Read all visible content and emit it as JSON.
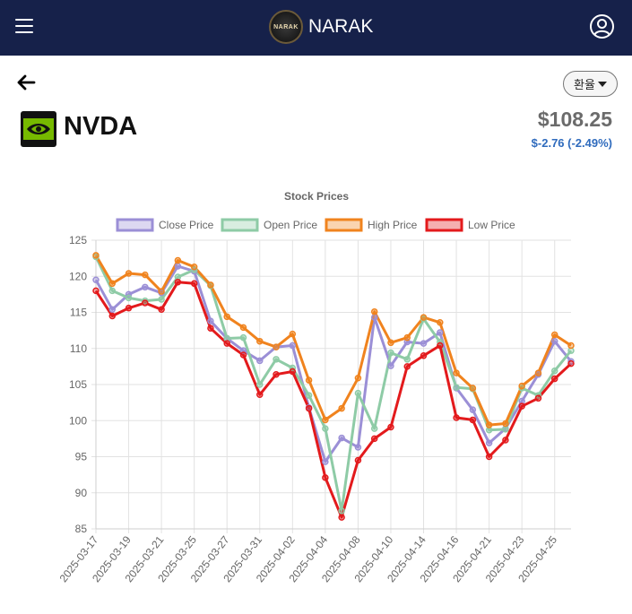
{
  "header": {
    "brand_name": "NARAK",
    "logo_text": "NARAK",
    "menu_icon": "hamburger-menu-icon",
    "account_icon": "user-circle-icon",
    "background": "#16214a"
  },
  "controls": {
    "back_icon": "arrow-left-icon",
    "currency_label": "환율"
  },
  "stock": {
    "ticker": "NVDA",
    "price": "$108.25",
    "change": "$-2.76 (-2.49%)",
    "change_color": "#2f6bbd",
    "logo_icon": "nvidia-eye-icon"
  },
  "chart_data": {
    "type": "line",
    "title": "Stock Prices",
    "legend_position": "top",
    "grid": true,
    "ylim": [
      85,
      125
    ],
    "y_ticks": [
      125,
      120,
      115,
      110,
      105,
      100,
      95,
      90,
      85
    ],
    "x_tick_labels": [
      "2025-03-17",
      "2025-03-19",
      "2025-03-21",
      "2025-03-25",
      "2025-03-27",
      "2025-03-31",
      "2025-04-02",
      "2025-04-04",
      "2025-04-08",
      "2025-04-10",
      "2025-04-14",
      "2025-04-16",
      "2025-04-21",
      "2025-04-23",
      "2025-04-25"
    ],
    "x": [
      "2025-03-17",
      "2025-03-18",
      "2025-03-19",
      "2025-03-20",
      "2025-03-21",
      "2025-03-24",
      "2025-03-25",
      "2025-03-26",
      "2025-03-27",
      "2025-03-28",
      "2025-03-31",
      "2025-04-01",
      "2025-04-02",
      "2025-04-03",
      "2025-04-04",
      "2025-04-07",
      "2025-04-08",
      "2025-04-09",
      "2025-04-10",
      "2025-04-11",
      "2025-04-14",
      "2025-04-15",
      "2025-04-16",
      "2025-04-17",
      "2025-04-21",
      "2025-04-22",
      "2025-04-23",
      "2025-04-24",
      "2025-04-25",
      "2025-04-28"
    ],
    "series": [
      {
        "name": "Close Price",
        "color": "#9b8fd6",
        "values": [
          119.5,
          115.4,
          117.5,
          118.5,
          117.7,
          121.4,
          120.7,
          113.8,
          111.4,
          109.7,
          108.3,
          110.2,
          110.4,
          101.8,
          94.3,
          97.6,
          96.3,
          114.3,
          107.6,
          110.9,
          110.7,
          112.2,
          104.5,
          101.5,
          96.9,
          98.9,
          102.7,
          106.4,
          111.0,
          108.2
        ]
      },
      {
        "name": "Open Price",
        "color": "#8ecba6",
        "values": [
          122.7,
          118.0,
          117.0,
          116.6,
          116.8,
          119.9,
          120.9,
          118.7,
          111.4,
          111.5,
          105.0,
          108.5,
          107.3,
          103.5,
          98.9,
          87.5,
          103.8,
          98.9,
          109.4,
          108.5,
          114.1,
          110.9,
          104.6,
          104.4,
          98.7,
          98.8,
          104.5,
          103.5,
          106.9,
          109.7
        ]
      },
      {
        "name": "High Price",
        "color": "#f0831e",
        "values": [
          122.9,
          119.0,
          120.4,
          120.2,
          117.9,
          122.2,
          121.3,
          118.8,
          114.4,
          112.9,
          111.0,
          110.2,
          112.0,
          105.6,
          100.1,
          101.7,
          105.9,
          115.1,
          110.8,
          111.5,
          114.3,
          113.6,
          106.6,
          104.5,
          99.4,
          99.6,
          104.8,
          106.6,
          111.9,
          110.4
        ]
      },
      {
        "name": "Low Price",
        "color": "#e31a1c",
        "values": [
          118.0,
          114.5,
          115.6,
          116.3,
          115.4,
          119.2,
          119.0,
          112.8,
          110.7,
          109.1,
          103.6,
          106.4,
          106.8,
          101.7,
          92.1,
          86.6,
          94.5,
          97.5,
          99.1,
          107.5,
          109.0,
          110.4,
          100.4,
          100.1,
          95.0,
          97.3,
          102.0,
          103.1,
          105.8,
          107.9
        ]
      }
    ]
  }
}
